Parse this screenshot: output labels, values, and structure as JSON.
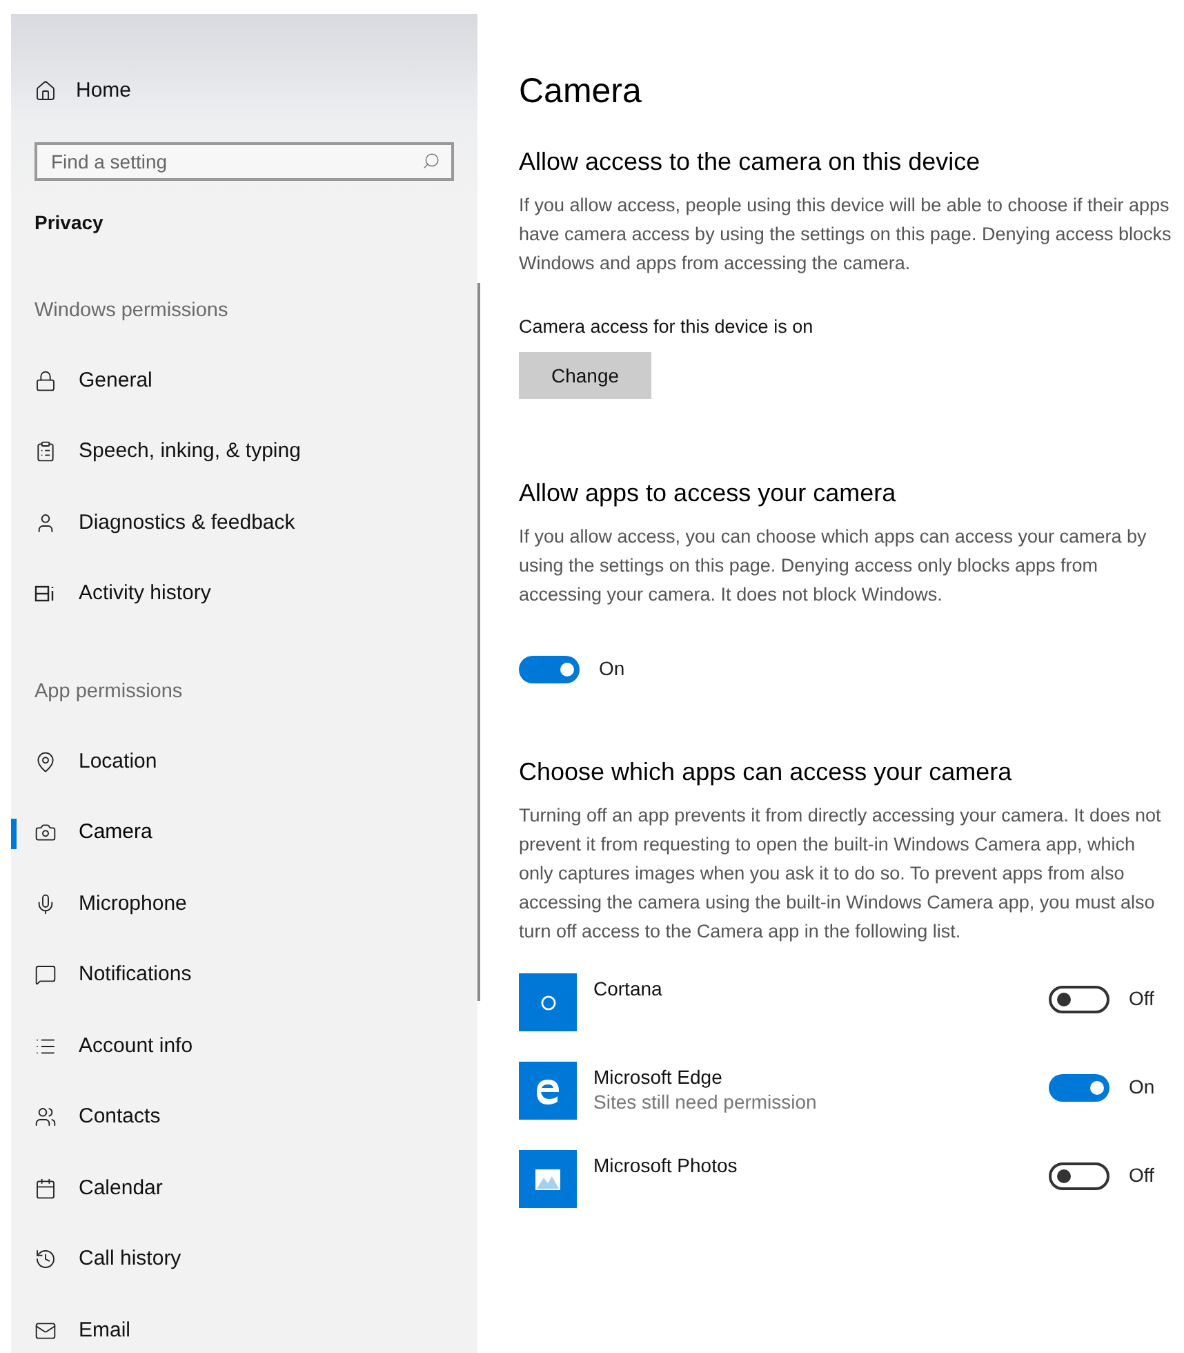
{
  "sidebar": {
    "home": {
      "label": "Home"
    },
    "search": {
      "placeholder": "Find a setting"
    },
    "section_title": "Privacy",
    "groups": [
      {
        "heading": "Windows permissions",
        "items": [
          {
            "label": "General",
            "selected": false
          },
          {
            "label": "Speech, inking, & typing",
            "selected": false
          },
          {
            "label": "Diagnostics & feedback",
            "selected": false
          },
          {
            "label": "Activity history",
            "selected": false
          }
        ]
      },
      {
        "heading": "App permissions",
        "items": [
          {
            "label": "Location",
            "selected": false
          },
          {
            "label": "Camera",
            "selected": true
          },
          {
            "label": "Microphone",
            "selected": false
          },
          {
            "label": "Notifications",
            "selected": false
          },
          {
            "label": "Account info",
            "selected": false
          },
          {
            "label": "Contacts",
            "selected": false
          },
          {
            "label": "Calendar",
            "selected": false
          },
          {
            "label": "Call history",
            "selected": false
          },
          {
            "label": "Email",
            "selected": false
          }
        ]
      }
    ]
  },
  "page": {
    "title": "Camera",
    "device_section": {
      "heading": "Allow access to the camera on this device",
      "description": "If you allow access, people using this device will be able to choose if their apps have camera access by using the settings on this page. Denying access blocks Windows and apps from accessing the camera.",
      "status": "Camera access for this device is on",
      "button": "Change"
    },
    "apps_section": {
      "heading": "Allow apps to access your camera",
      "description": "If you allow access, you can choose which apps can access your camera by using the settings on this page. Denying access only blocks apps from accessing your camera. It does not block Windows.",
      "toggle": {
        "on": true,
        "label": "On"
      }
    },
    "choose_section": {
      "heading": "Choose which apps can access your camera",
      "description": "Turning off an app prevents it from directly accessing your camera. It does not prevent it from requesting to open the built-in Windows Camera app, which only captures images when you ask it to do so. To prevent apps from also accessing the camera using the built-in Windows Camera app, you must also turn off access to the Camera app in the following list.",
      "apps": [
        {
          "name": "Cortana",
          "toggle": {
            "on": false,
            "label": "Off"
          }
        },
        {
          "name": "Microsoft Edge",
          "subtitle": "Sites still need permission",
          "toggle": {
            "on": true,
            "label": "On"
          }
        },
        {
          "name": "Microsoft Photos",
          "toggle": {
            "on": false,
            "label": "Off"
          }
        }
      ]
    }
  }
}
